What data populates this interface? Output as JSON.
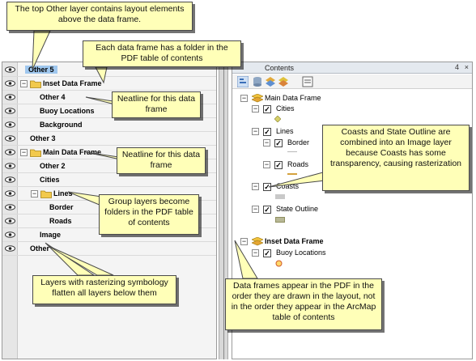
{
  "left_layers": [
    {
      "label": "Other 5",
      "level": 0,
      "selected": true,
      "expander": "",
      "folder": false
    },
    {
      "label": "Inset Data Frame",
      "level": 0,
      "selected": false,
      "expander": "−",
      "folder": true
    },
    {
      "label": "Other 4",
      "level": 1,
      "selected": false,
      "expander": "",
      "folder": false
    },
    {
      "label": "Buoy Locations",
      "level": 1,
      "selected": false,
      "expander": "",
      "folder": false
    },
    {
      "label": "Background",
      "level": 1,
      "selected": false,
      "expander": "",
      "folder": false
    },
    {
      "label": "Other 3",
      "level": 0,
      "selected": false,
      "expander": "",
      "folder": false
    },
    {
      "label": "Main Data Frame",
      "level": 0,
      "selected": false,
      "expander": "−",
      "folder": true
    },
    {
      "label": "Other 2",
      "level": 1,
      "selected": false,
      "expander": "",
      "folder": false
    },
    {
      "label": "Cities",
      "level": 1,
      "selected": false,
      "expander": "",
      "folder": false
    },
    {
      "label": "Lines",
      "level": 1,
      "selected": false,
      "expander": "−",
      "folder": true
    },
    {
      "label": "Border",
      "level": 2,
      "selected": false,
      "expander": "",
      "folder": false
    },
    {
      "label": "Roads",
      "level": 2,
      "selected": false,
      "expander": "",
      "folder": false
    },
    {
      "label": "Image",
      "level": 1,
      "selected": false,
      "expander": "",
      "folder": false
    },
    {
      "label": "Other",
      "level": 0,
      "selected": false,
      "expander": "",
      "folder": false
    }
  ],
  "toc": {
    "title": "Contents",
    "pin": "4",
    "close": "×",
    "items": {
      "main_frame": "Main Data Frame",
      "cities": "Cities",
      "lines": "Lines",
      "border": "Border",
      "roads": "Roads",
      "coasts": "Coasts",
      "state_outline": "State Outline",
      "inset_frame": "Inset Data Frame",
      "buoy": "Buoy Locations"
    }
  },
  "callouts": {
    "top_other": "The top Other layer contains layout elements above the data frame.",
    "folder": "Each data frame has a folder in the PDF table of contents",
    "neatline1": "Neatline for this data frame",
    "neatline2": "Neatline for this data frame",
    "group_layers": "Group layers become folders in the PDF table of contents",
    "rasterizing": "Layers with rasterizing symbology flatten all layers below them",
    "coasts": "Coasts and State Outline are combined into an Image layer because Coasts has some transparency, causing rasterization",
    "order": "Data frames appear in the PDF in the order they are drawn in the layout, not in the order they appear in the ArcMap table of contents"
  },
  "colors": {
    "callout_bg": "#ffffb8",
    "selection": "#9fc7ee",
    "folder": "#f2c94c",
    "road_line": "#d4a23e",
    "border_line": "#b8b8b8",
    "coasts_swatch": "#c9c9c9",
    "state_swatch": "#b8b896"
  }
}
